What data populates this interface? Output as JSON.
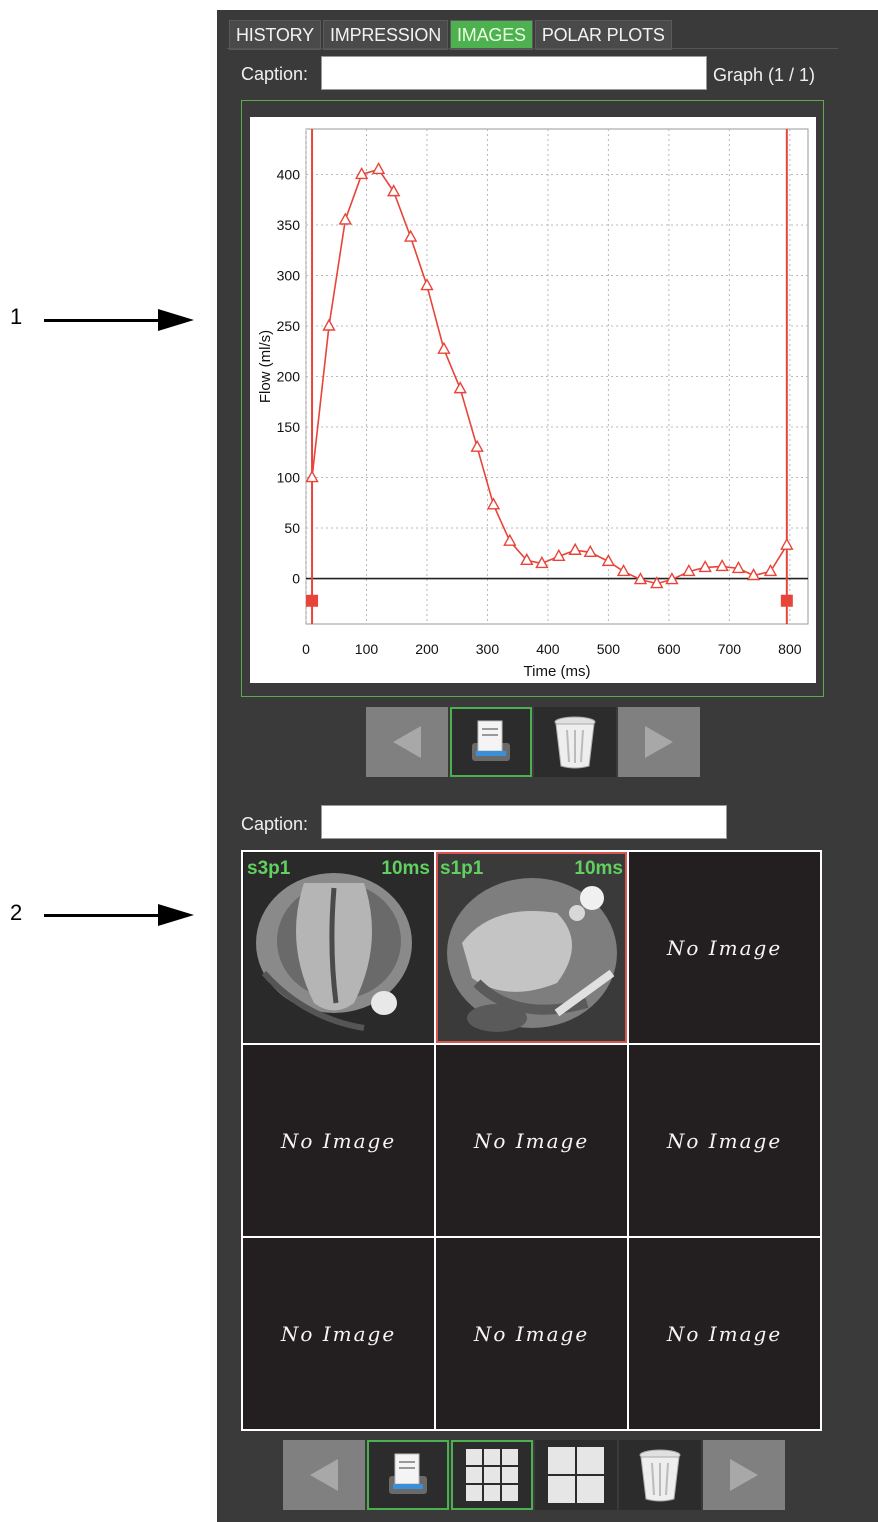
{
  "callouts": {
    "one": "1",
    "two": "2"
  },
  "tabs": [
    {
      "label": "HISTORY",
      "active": false
    },
    {
      "label": "IMPRESSION",
      "active": false
    },
    {
      "label": "IMAGES",
      "active": true
    },
    {
      "label": "POLAR PLOTS",
      "active": false
    }
  ],
  "graph_section": {
    "caption_label": "Caption:",
    "caption_value": "",
    "counter": "Graph (1 / 1)"
  },
  "image_section": {
    "caption_label": "Caption:",
    "caption_value": "",
    "thumbnails": [
      {
        "series": "s3p1",
        "time": "10ms"
      },
      {
        "series": "s1p1",
        "time": "10ms"
      }
    ],
    "no_image_label": "No Image"
  },
  "icons": {
    "prev": "left-arrow-icon",
    "print": "printer-icon",
    "delete": "trash-icon",
    "next": "right-arrow-icon",
    "grid3": "grid-3x3-icon",
    "grid2": "grid-2x2-icon"
  },
  "colors": {
    "accent": "#4db14f",
    "curve": "#e8443a",
    "panel": "#3a3a3a"
  },
  "chart_data": {
    "type": "line",
    "xlabel": "Time (ms)",
    "ylabel": "Flow (ml/s)",
    "xlim": [
      0,
      830
    ],
    "ylim": [
      -45,
      445
    ],
    "xticks": [
      0,
      100,
      200,
      300,
      400,
      500,
      600,
      700,
      800
    ],
    "yticks": [
      0,
      50,
      100,
      150,
      200,
      250,
      300,
      350,
      400
    ],
    "grid": true,
    "cursors": [
      10,
      795
    ],
    "series": [
      {
        "x": [
          10,
          38,
          65,
          92,
          120,
          145,
          173,
          200,
          228,
          255,
          283,
          310,
          337,
          365,
          390,
          418,
          445,
          470,
          500,
          525,
          553,
          580,
          605,
          633,
          660,
          688,
          715,
          740,
          768,
          795
        ],
        "y": [
          100,
          250,
          355,
          400,
          405,
          383,
          338,
          290,
          227,
          188,
          130,
          73,
          37,
          18,
          15,
          22,
          28,
          26,
          17,
          7,
          -1,
          -5,
          -1,
          7,
          11,
          12,
          10,
          3,
          7,
          33
        ]
      }
    ]
  }
}
